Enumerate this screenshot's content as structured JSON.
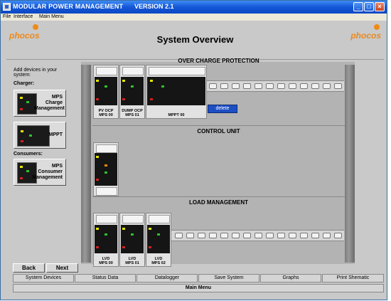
{
  "window": {
    "app_title": "MODULAR POWER MANAGEMENT",
    "version": "VERSION 2.1",
    "controls": {
      "minimize": "_",
      "maximize": "□",
      "close": "×"
    }
  },
  "menubar": {
    "items": [
      "File",
      "Interface",
      "Main Menu"
    ]
  },
  "header": {
    "logo_left": "phocos",
    "logo_right": "phocos",
    "title": "System Overview"
  },
  "sidebar": {
    "intro": "Add devices in your system:",
    "charger_label": "Charger:",
    "consumers_label": "Consumers:",
    "devices": [
      {
        "label": "MPS Charge Management"
      },
      {
        "label": "MPPT"
      },
      {
        "label": "MPS Consumer Management"
      }
    ]
  },
  "sections": {
    "over_charge": "OVER CHARGE PROTECTION",
    "control_unit": "CONTROL UNIT",
    "load_management": "LOAD MANAGEMENT"
  },
  "modules": {
    "ocp": [
      {
        "line1": "PV OCP",
        "line2": "MPS 00"
      },
      {
        "line1": "DUMP OCP",
        "line2": "MPS 01"
      },
      {
        "line1": "MPPT 00",
        "line2": ""
      }
    ],
    "lvd": [
      {
        "line1": "LVD",
        "line2": "MPS 00"
      },
      {
        "line1": "LVD",
        "line2": "MPS 01"
      },
      {
        "line1": "LVD",
        "line2": "MPS 02"
      }
    ]
  },
  "context_menu": {
    "delete_label": "delete"
  },
  "nav": {
    "back": "Back",
    "next": "Next"
  },
  "tabs": [
    "System Devices",
    "Status Data",
    "Datalogger",
    "Save System",
    "Graphs",
    "Print Shematic"
  ],
  "main_menu_label": "Main Menu",
  "colors": {
    "titlebar": "#1457d6",
    "logo": "#e98a20",
    "context_menu": "#1e4fc2"
  }
}
